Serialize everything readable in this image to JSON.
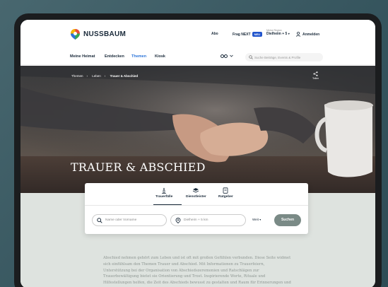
{
  "brand": {
    "name": "NUSSBAUM"
  },
  "topbar": {
    "abo": "Abo",
    "frag_next_label": "Frag NEXT",
    "frag_next_badge": "NEU",
    "region_label": "Meine Region",
    "region_value": "Dielheim + 5",
    "login": "Anmelden"
  },
  "nav": {
    "items": [
      "Meine Heimat",
      "Entdecken",
      "Themen",
      "Kiosk"
    ],
    "active": "Themen",
    "search_placeholder": "Suche Beiträge, Events & Profile"
  },
  "hero": {
    "breadcrumb": [
      "Themen",
      "Leben",
      "Trauer & Abschied"
    ],
    "share_label": "Teilen",
    "title": "TRAUER & ABSCHIED"
  },
  "search_card": {
    "tabs": [
      {
        "label": "Trauerfälle",
        "icon": "candle-icon",
        "active": true
      },
      {
        "label": "Dienstleister",
        "icon": "layers-icon",
        "active": false
      },
      {
        "label": "Ratgeber",
        "icon": "book-icon",
        "active": false
      }
    ],
    "name_placeholder": "Name oder Vorname",
    "location_placeholder": "Dielheim + 5 km",
    "distance": "Weit",
    "search_button": "Suchen"
  },
  "intro_text": "Abschied nehmen gehört zum Leben und ist oft mit großen Gefühlen verbunden. Diese Seite widmet sich einfühlsam den Themen Trauer und Abschied. Mit Informationen zu Trauerfeiern, Unterstützung bei der Organisation von Abschiedszeremonien und Ratschlägen zur Trauerbewältigung bietet sie Orientierung und Trost. Inspirierende Worte, Rituale und Hilfestellungen helfen, die Zeit des Abschieds bewusst zu gestalten und Raum für Erinnerungen und Heilung zu schaffen.",
  "colors": {
    "accent": "#2b74d9",
    "badge": "#2255cc",
    "search_button": "#7a8a86",
    "lower_bg": "#dee3df"
  }
}
